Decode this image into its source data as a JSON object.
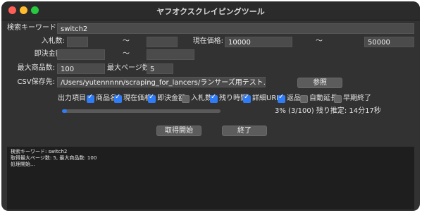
{
  "window": {
    "title": "ヤフオクスクレイピングツール"
  },
  "form": {
    "keyword_label": "検索キーワード:",
    "keyword_value": "switch2",
    "bids_label": "入札数:",
    "bids_min": "",
    "bids_max": "",
    "range_sep": "〜",
    "price_label": "現在価格:",
    "price_min": "10000",
    "price_max": "50000",
    "buynow_label": "即決金額:",
    "buynow_min": "",
    "buynow_max": "",
    "max_items_label": "最大商品数:",
    "max_items_value": "100",
    "max_pages_label": "最大ページ数:",
    "max_pages_value": "5",
    "csv_label": "CSV保存先:",
    "csv_path": "/Users/yutennnnn/scraping_for_lancers/ランサーズ用テスト.csv",
    "browse_button": "参照"
  },
  "output_items": {
    "label": "出力項目:",
    "items": [
      {
        "label": "商品名",
        "checked": true
      },
      {
        "label": "現在価格",
        "checked": true
      },
      {
        "label": "即決金額",
        "checked": false
      },
      {
        "label": "入札数",
        "checked": true
      },
      {
        "label": "残り時間",
        "checked": true
      },
      {
        "label": "詳細URL",
        "checked": true
      },
      {
        "label": "返品",
        "checked": false
      },
      {
        "label": "自動延長",
        "checked": false
      },
      {
        "label": "早期終了",
        "checked": false
      }
    ]
  },
  "progress": {
    "value": 0.03,
    "status": "3% (3/100) 残り推定: 14分17秒"
  },
  "buttons": {
    "start": "取得開始",
    "quit": "終了"
  },
  "log": {
    "lines": [
      "検索キーワード: switch2",
      "取得最大ページ数: 5, 最大商品数: 100",
      "処理開始..."
    ]
  },
  "colors": {
    "accent": "#2f7cf6",
    "window_bg": "#323232",
    "log_bg": "#1e1e1e"
  }
}
